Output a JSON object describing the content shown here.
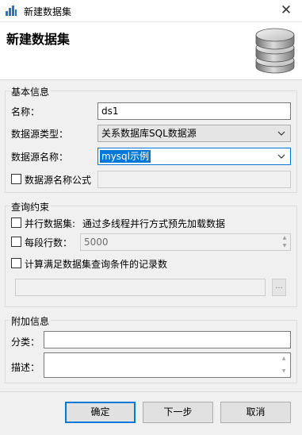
{
  "window": {
    "title": "新建数据集",
    "close_glyph": "✕",
    "app_icon": "bar-chart-icon"
  },
  "header": {
    "title": "新建数据集",
    "icon": "database-icon"
  },
  "basic": {
    "group_title": "基本信息",
    "name_label": "名称：",
    "name_value": "ds1",
    "type_label": "数据源类型：",
    "type_value": "关系数据库SQL数据源",
    "source_label": "数据源名称：",
    "source_value": "mysql示例",
    "formula_label": "数据源名称公式",
    "formula_value": ""
  },
  "query": {
    "group_title": "查询约束",
    "parallel_label": "并行数据集:",
    "parallel_desc": "通过多线程并行方式预先加载数据",
    "rows_label": "每段行数：",
    "rows_value": "5000",
    "count_label": "计算满足数据集查询条件的记录数",
    "count_value": "",
    "browse_label": "..."
  },
  "extra": {
    "group_title": "附加信息",
    "category_label": "分类：",
    "category_value": "",
    "desc_label": "描述：",
    "desc_value": ""
  },
  "buttons": {
    "ok": "确定",
    "next": "下一步",
    "cancel": "取消"
  },
  "colors": {
    "accent": "#0078d7",
    "window_bg": "#f0f0f0"
  }
}
